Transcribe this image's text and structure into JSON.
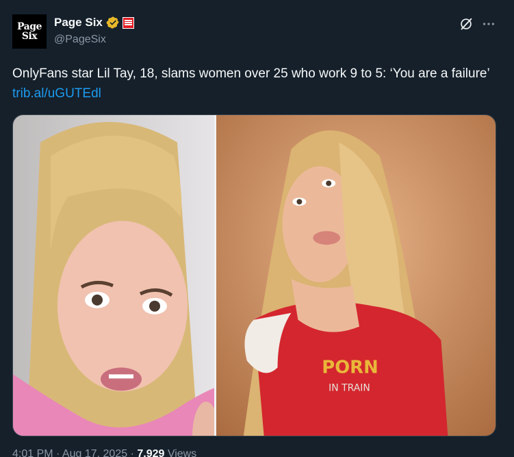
{
  "author": {
    "display_name": "Page Six",
    "handle": "@PageSix",
    "avatar_text_line1": "Page",
    "avatar_text_line2": "Six",
    "verified_icon": "verified-gold-check-icon",
    "affiliate_badge_icon": "new-york-post-badge-icon"
  },
  "tweet": {
    "text": "OnlyFans star Lil Tay, 18, slams women over 25 who work 9 to 5: ‘You are a failure’",
    "link": "trib.al/uGUTEdl"
  },
  "media": {
    "images": [
      {
        "name": "left-photo",
        "description_icon": "photo"
      },
      {
        "name": "right-photo",
        "description_icon": "photo"
      }
    ]
  },
  "footer": {
    "time": "4:01 PM · Aug 17, 2025 · ",
    "views_count": "7,929",
    "views_label": " Views"
  },
  "colors": {
    "background": "#15202b",
    "text": "#f7f9f9",
    "secondary": "#8b98a5",
    "link": "#1d9bf0",
    "verified": "#e8b829"
  }
}
